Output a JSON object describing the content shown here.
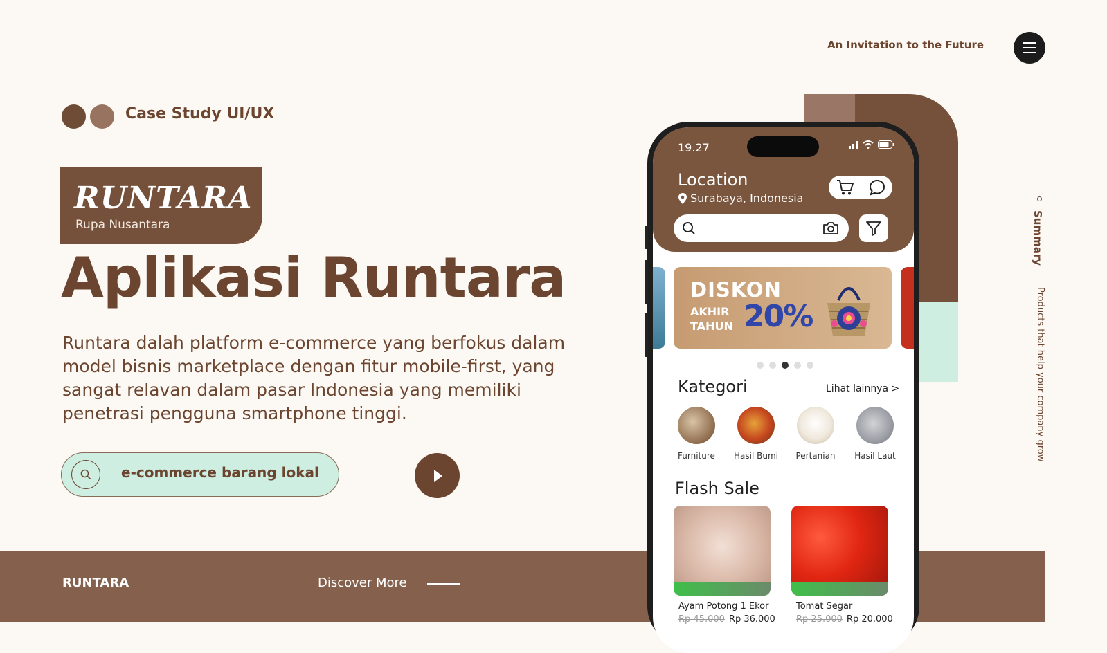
{
  "header": {
    "tagline": "An Invitation to the Future",
    "menu_icon": "hamburger-menu-icon"
  },
  "hero": {
    "case_label": "Case Study UI/UX",
    "logo_word": "RUNTARA",
    "logo_sub": "Rupa Nusantara",
    "headline": "Aplikasi Runtara",
    "description": "Runtara dalah platform e-commerce yang berfokus dalam model bisnis marketplace dengan fitur mobile-first, yang sangat relavan dalam pasar Indonesia yang memiliki penetrasi pengguna smartphone tinggi.",
    "search_text": "e-commerce barang lokal"
  },
  "side": {
    "summary": "Summary",
    "products": "Products that help your company grow"
  },
  "footer": {
    "brand": "RUNTARA",
    "discover": "Discover More"
  },
  "phone": {
    "time": "19.27",
    "location_title": "Location",
    "location_value": "Surabaya, Indonesia",
    "banner": {
      "line1": "DISKON",
      "line2": "AKHIR\nTAHUN",
      "percent": "20%"
    },
    "carousel": {
      "count": 5,
      "active": 3
    },
    "kategori_title": "Kategori",
    "kategori_more": "Lihat lainnya >",
    "categories": [
      {
        "label": "Furniture"
      },
      {
        "label": "Hasil Bumi"
      },
      {
        "label": "Pertanian"
      },
      {
        "label": "Hasil Laut"
      }
    ],
    "flash_title": "Flash Sale",
    "flash_items": [
      {
        "name": "Ayam Potong 1 Ekor",
        "old_price": "Rp 45.000",
        "price": "Rp 36.000"
      },
      {
        "name": "Tomat Segar",
        "old_price": "Rp 25.000",
        "price": "Rp 20.000"
      }
    ]
  },
  "colors": {
    "primary": "#6b4530",
    "mint": "#cdeee0",
    "background": "#fcf9f4",
    "footer": "#85614d"
  }
}
